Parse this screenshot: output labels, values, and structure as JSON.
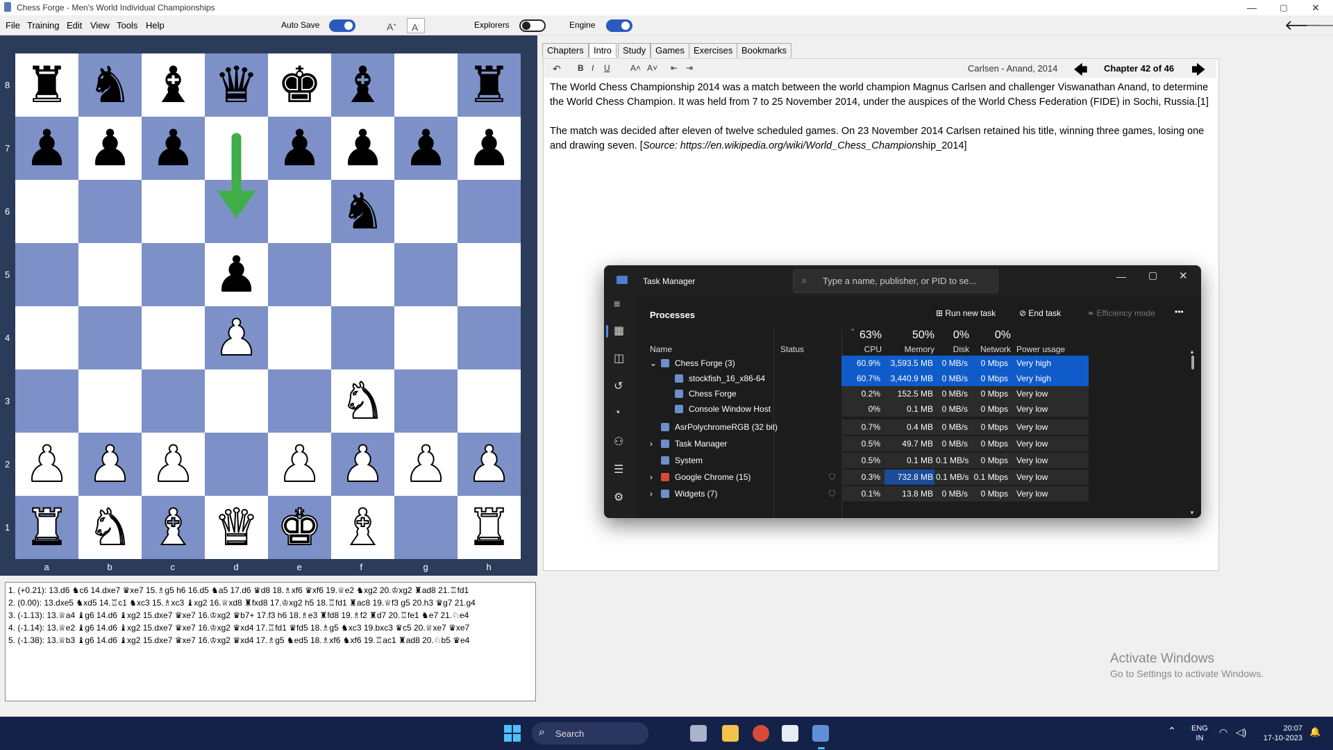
{
  "window": {
    "title": "Chess Forge - Men's World Individual Championships",
    "controls": [
      "—",
      "▢",
      "✕"
    ]
  },
  "menu": {
    "items": [
      "File",
      "Training",
      "Edit",
      "View",
      "Tools",
      "Help"
    ]
  },
  "toolbar": {
    "auto_save_label": "Auto Save",
    "auto_save_on": true,
    "font_up": "A",
    "font_down": "A",
    "explorers_label": "Explorers",
    "explorers_on": false,
    "engine_label": "Engine",
    "engine_on": true,
    "back_arrow": "🡐",
    "forward_arrow": "🡒"
  },
  "board": {
    "ranks": [
      "8",
      "7",
      "6",
      "5",
      "4",
      "3",
      "2",
      "1"
    ],
    "files": [
      "a",
      "b",
      "c",
      "d",
      "e",
      "f",
      "g",
      "h"
    ],
    "position": [
      [
        "br",
        "bn",
        "bb",
        "bq",
        "bk",
        "bb",
        "",
        "br"
      ],
      [
        "bp",
        "bp",
        "bp",
        "",
        "bp",
        "bp",
        "bp",
        "bp"
      ],
      [
        "",
        "",
        "",
        "",
        "",
        "bn",
        "",
        ""
      ],
      [
        "",
        "",
        "",
        "bp",
        "",
        "",
        "",
        ""
      ],
      [
        "",
        "",
        "",
        "wp",
        "",
        "",
        "",
        ""
      ],
      [
        "",
        "",
        "",
        "",
        "",
        "wn",
        "",
        ""
      ],
      [
        "wp",
        "wp",
        "wp",
        "",
        "wp",
        "wp",
        "wp",
        "wp"
      ],
      [
        "wr",
        "wn",
        "wb",
        "wq",
        "wk",
        "wb",
        "",
        "wr"
      ]
    ],
    "arrow": {
      "from": "d7",
      "to": "d6",
      "color": "#3fae49"
    }
  },
  "engine_lines": [
    "1. (+0.21): 13.d6 ♞c6 14.dxe7 ♛xe7 15.♗g5 h6 16.d5 ♞a5 17.d6 ♛d8 18.♗xf6 ♛xf6 19.♕e2 ♞xg2 20.♔xg2 ♜ad8 21.♖fd1",
    "2. (0.00): 13.dxe5 ♞xd5 14.♖c1 ♞xc3 15.♗xc3 ♝xg2 16.♕xd8 ♜fxd8 17.♔xg2 h5 18.♖fd1 ♜ac8 19.♕f3 g5 20.h3 ♛g7 21.g4",
    "3. (-1.13): 13.♕a4 ♝g6 14.d6 ♝xg2 15.dxe7 ♛xe7 16.♔xg2 ♛b7+ 17.f3 h6 18.♗e3 ♜fd8 19.♗f2 ♜d7 20.♖fe1 ♞e7 21.♘e4",
    "4. (-1.14): 13.♕e2 ♝g6 14.d6 ♝xg2 15.dxe7 ♛xe7 16.♔xg2 ♛xd4 17.♖fd1 ♛fd5 18.♗g5 ♞xc3 19.bxc3 ♛c5 20.♕xe7 ♛xe7",
    "5. (-1.38): 13.♕b3 ♝g6 14.d6 ♝xg2 15.dxe7 ♛xe7 16.♔xg2 ♛xd4 17.♗g5 ♞ed5 18.♗xf6 ♞xf6 19.♖ac1 ♜ad8 20.♘b5 ♛e4"
  ],
  "tabs": [
    "Chapters",
    "Intro",
    "Study",
    "Games",
    "Exercises",
    "Bookmarks"
  ],
  "active_tab": "Intro",
  "intro": {
    "tools": [
      "↶",
      "B",
      "I",
      "U",
      "A˄",
      "A˅",
      "⇤",
      "⇥"
    ],
    "game_label": "Carlsen - Anand, 2014",
    "chapter_label": "Chapter 42 of 46",
    "paragraph1": "The World Chess Championship 2014 was a match between the world champion Magnus Carlsen and challenger Viswanathan Anand, to determine the World Chess Champion. It was held from 7 to 25 November 2014, under the auspices of the World Chess Federation (FIDE) in Sochi, Russia.[1]",
    "paragraph2_main": "The match was decided after eleven of twelve scheduled games. On 23 November 2014 Carlsen retained his title, winning three games, losing one and drawing seven. [",
    "paragraph2_source": "Source: https://en.wikipedia.org/wiki/World_Chess_Champion",
    "paragraph2_end": "ship_2014]"
  },
  "task_manager": {
    "title": "Task Manager",
    "search_placeholder": "Type a name, publisher, or PID to se...",
    "section": "Processes",
    "run_new_task": "Run new task",
    "end_task": "End task",
    "efficiency_mode": "Efficiency mode",
    "more": "•••",
    "columns": {
      "name": "Name",
      "status": "Status",
      "cpu": "CPU",
      "memory": "Memory",
      "disk": "Disk",
      "network": "Network",
      "power": "Power usage"
    },
    "totals": {
      "cpu": "63%",
      "memory": "50%",
      "disk": "0%",
      "network": "0%"
    },
    "highlight_color": "#0f5bc9",
    "rows": [
      {
        "name": "Chess Forge (3)",
        "indent": 0,
        "expand": "⌄",
        "cpu": "60.9%",
        "memory": "3,593.5 MB",
        "disk": "0 MB/s",
        "network": "0 Mbps",
        "power": "Very high",
        "hot": true
      },
      {
        "name": "stockfish_16_x86-64",
        "indent": 1,
        "expand": "",
        "cpu": "60.7%",
        "memory": "3,440.9 MB",
        "disk": "0 MB/s",
        "network": "0 Mbps",
        "power": "Very high",
        "hot": true
      },
      {
        "name": "Chess Forge",
        "indent": 1,
        "expand": "",
        "cpu": "0.2%",
        "memory": "152.5 MB",
        "disk": "0 MB/s",
        "network": "0 Mbps",
        "power": "Very low",
        "hot": false
      },
      {
        "name": "Console Window Host",
        "indent": 1,
        "expand": "",
        "cpu": "0%",
        "memory": "0.1 MB",
        "disk": "0 MB/s",
        "network": "0 Mbps",
        "power": "Very low",
        "hot": false
      },
      {
        "name": "AsrPolychromeRGB (32 bit)",
        "indent": 0,
        "expand": "",
        "cpu": "0.7%",
        "memory": "0.4 MB",
        "disk": "0 MB/s",
        "network": "0 Mbps",
        "power": "Very low",
        "hot": false
      },
      {
        "name": "Task Manager",
        "indent": 0,
        "expand": "›",
        "cpu": "0.5%",
        "memory": "49.7 MB",
        "disk": "0 MB/s",
        "network": "0 Mbps",
        "power": "Very low",
        "hot": false
      },
      {
        "name": "System",
        "indent": 0,
        "expand": "",
        "cpu": "0.5%",
        "memory": "0.1 MB",
        "disk": "0.1 MB/s",
        "network": "0 Mbps",
        "power": "Very low",
        "hot": false
      },
      {
        "name": "Google Chrome (15)",
        "indent": 0,
        "expand": "›",
        "cpu": "0.3%",
        "memory": "732.8 MB",
        "disk": "0.1 MB/s",
        "network": "0.1 Mbps",
        "power": "Very low",
        "hot": false,
        "mem_hot": true,
        "status_icon": true
      },
      {
        "name": "Widgets (7)",
        "indent": 0,
        "expand": "›",
        "cpu": "0.1%",
        "memory": "13.8 MB",
        "disk": "0 MB/s",
        "network": "0 Mbps",
        "power": "Very low",
        "hot": false,
        "status_icon": true
      }
    ]
  },
  "watermark": {
    "line1": "Activate Windows",
    "line2": "Go to Settings to activate Windows."
  },
  "taskbar": {
    "search_label": "Search",
    "lang": "ENG",
    "region": "IN",
    "time": "20:07",
    "date": "17-10-2023"
  }
}
